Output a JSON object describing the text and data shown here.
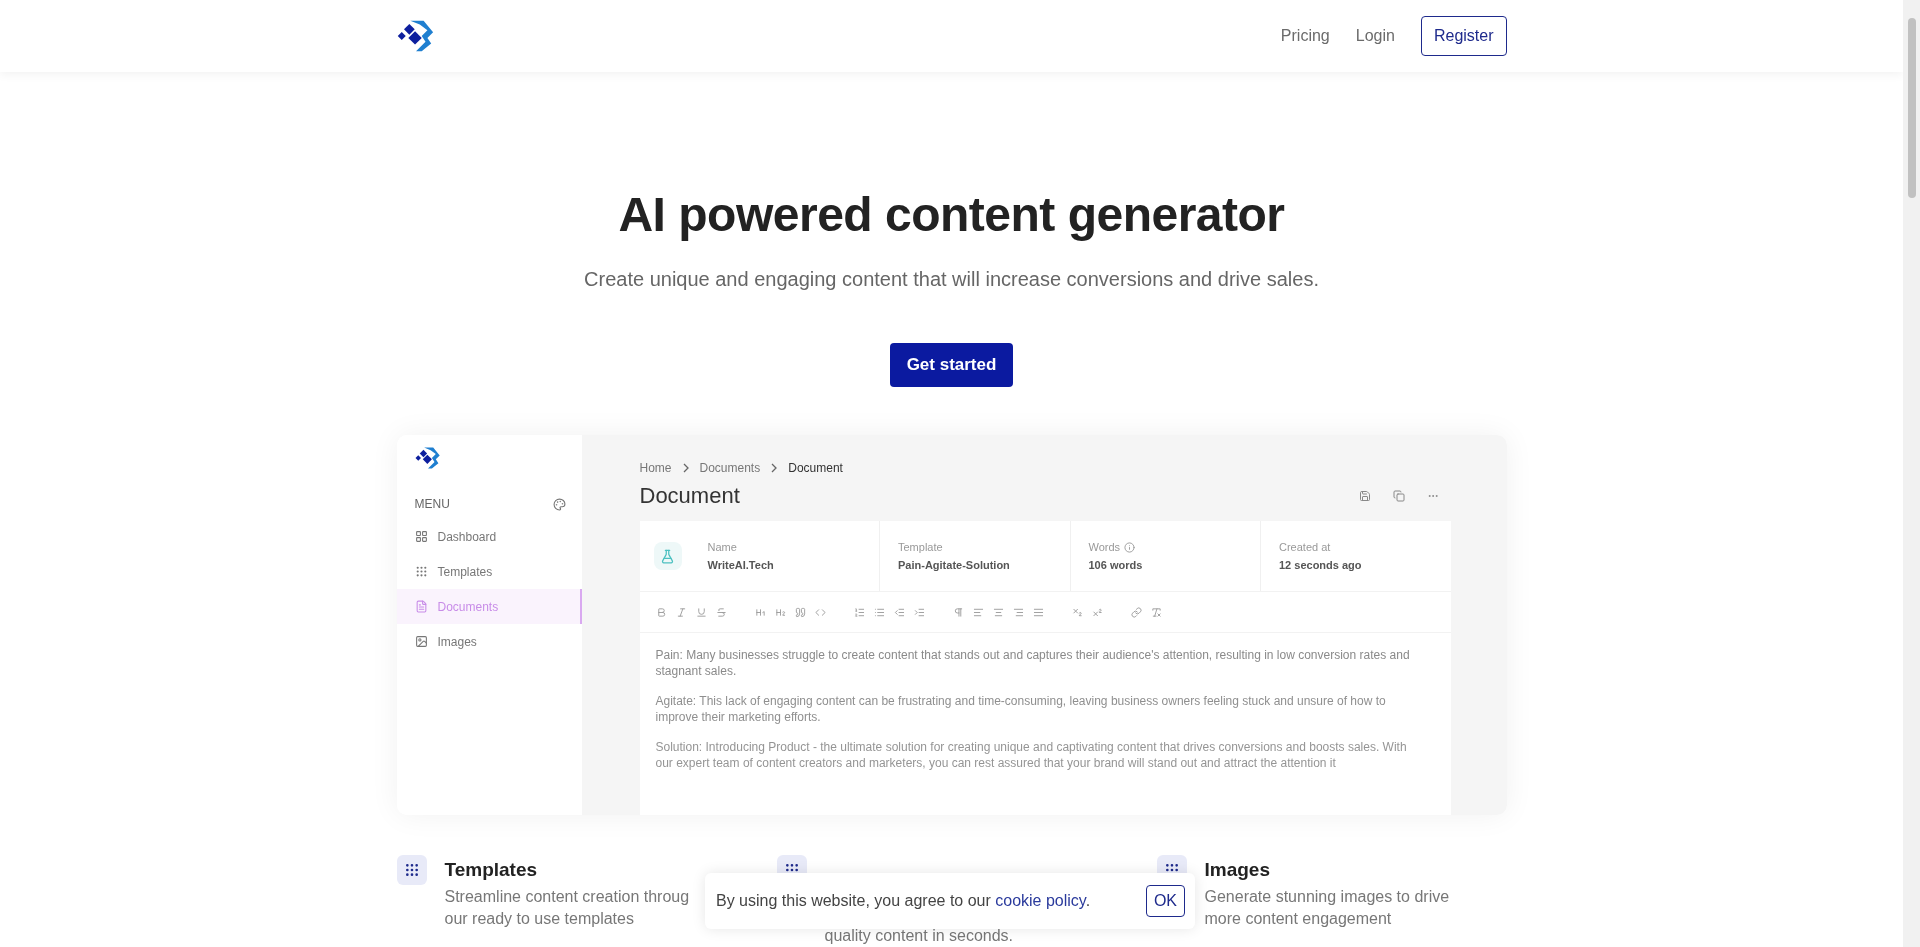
{
  "nav": {
    "links": [
      {
        "label": "Pricing",
        "kind": "link"
      },
      {
        "label": "Login",
        "kind": "link"
      },
      {
        "label": "Register",
        "kind": "button"
      }
    ]
  },
  "hero": {
    "title": "AI powered content generator",
    "subtitle": "Create unique and engaging content that will increase conversions and drive sales.",
    "cta": "Get started"
  },
  "preview": {
    "sidebar": {
      "menu_label": "MENU",
      "items": [
        {
          "label": "Dashboard",
          "selected": false
        },
        {
          "label": "Templates",
          "selected": false
        },
        {
          "label": "Documents",
          "selected": true
        },
        {
          "label": "Images",
          "selected": false
        }
      ]
    },
    "breadcrumb": [
      "Home",
      "Documents",
      "Document"
    ],
    "title": "Document",
    "meta": [
      {
        "label": "Name",
        "value": "WriteAI.Tech",
        "info": false
      },
      {
        "label": "Template",
        "value": "Pain-Agitate-Solution",
        "info": false
      },
      {
        "label": "Words",
        "value": "106 words",
        "info": true
      },
      {
        "label": "Created at",
        "value": "12 seconds ago",
        "info": false
      }
    ],
    "paragraphs": [
      {
        "text": "Pain: Many businesses struggle to create content that stands out and captures their audience's attention, resulting in low conversion rates and stagnant sales."
      },
      {
        "text": "Agitate: This lack of engaging content can be frustrating and time-consuming, leaving business owners feeling stuck and unsure of how to improve their marketing efforts."
      },
      {
        "text": "Solution: Introducing Product - the ultimate solution for creating unique and captivating content that drives conversions and boosts sales. With our expert team of content creators and marketers, you can rest assured that your brand will stand out and attract the attention it"
      }
    ]
  },
  "features": [
    {
      "title": "Templates",
      "lines": [
        "Streamline content creation throug",
        "our ready to use templates"
      ]
    },
    {
      "lines": [
        "quality content in seconds."
      ]
    },
    {
      "title": "Images",
      "lines": [
        "Generate stunning images to drive",
        "more content engagement"
      ]
    }
  ],
  "cookie_banner": {
    "text": "By using this website, you agree to our ",
    "link": "cookie policy",
    "after": ".",
    "button": "OK"
  }
}
